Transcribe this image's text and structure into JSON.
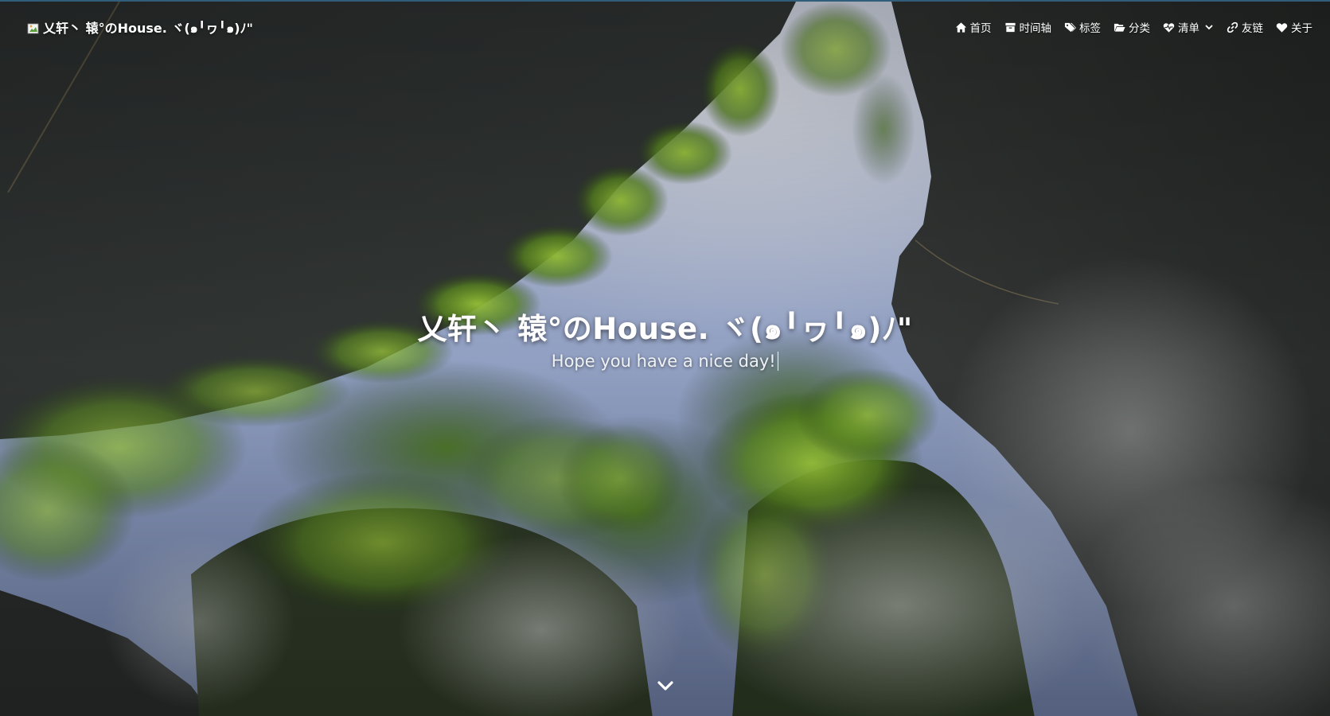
{
  "header": {
    "brand_text": "乂轩丶 辕°のHouse. ヾ(๑╹ヮ╹๑)ﾉ\""
  },
  "nav": {
    "items": [
      {
        "label": "首页",
        "icon": "home-icon"
      },
      {
        "label": "时间轴",
        "icon": "archive-icon"
      },
      {
        "label": "标签",
        "icon": "tags-icon"
      },
      {
        "label": "分类",
        "icon": "folder-open-icon"
      },
      {
        "label": "清单",
        "icon": "heartbeat-icon",
        "has_dropdown": true
      },
      {
        "label": "友链",
        "icon": "link-icon"
      },
      {
        "label": "关于",
        "icon": "heart-icon"
      }
    ]
  },
  "hero": {
    "title": "乂轩丶 辕°のHouse. ヾ(๑╹ヮ╹๑)ﾉ\"",
    "subtitle": "Hope you have a nice day!",
    "scroll_icon": "chevron-down-icon"
  },
  "colors": {
    "text": "#ffffff",
    "sky_top": "#8fa6cf",
    "foliage": "#7fae2e",
    "rock": "#262a29"
  }
}
